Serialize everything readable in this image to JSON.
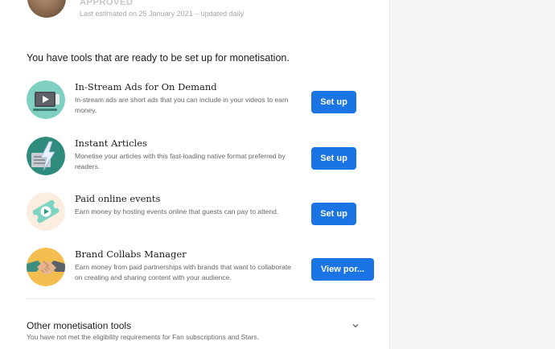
{
  "status": {
    "title": "APPROVED",
    "subtitle": "Last estimated on 25 January 2021 – updated daily"
  },
  "heading": "You have tools that are ready to be set up for monetisation.",
  "tools": [
    {
      "title": "In-Stream Ads for On Demand",
      "description": "In-stream ads are short ads that you can include in your videos to earn money.",
      "button": "Set up",
      "icon": "video-play-icon",
      "icon_bg": "#7fd0c1"
    },
    {
      "title": "Instant Articles",
      "description": "Monetise your articles with this fast-loading native format preferred by readers.",
      "button": "Set up",
      "icon": "lightning-article-icon",
      "icon_bg": "#2f8c7c"
    },
    {
      "title": "Paid online events",
      "description": "Earn money by hosting events online that guests can pay to attend.",
      "button": "Set up",
      "icon": "ticket-play-icon",
      "icon_bg": "#fbeede"
    },
    {
      "title": "Brand Collabs Manager",
      "description": "Earn money from paid partnerships with brands that want to collaborate on creating and sharing content with your audience.",
      "button": "View por...",
      "icon": "handshake-icon",
      "icon_bg": "#f3bd4f"
    }
  ],
  "other_tools": {
    "title": "Other monetisation tools",
    "subtitle": "You have not met the eligibility requirements for Fan subscriptions and Stars."
  },
  "colors": {
    "primary_button": "#1b74e4",
    "text_primary": "#1c1e21",
    "text_secondary": "#65676b"
  }
}
